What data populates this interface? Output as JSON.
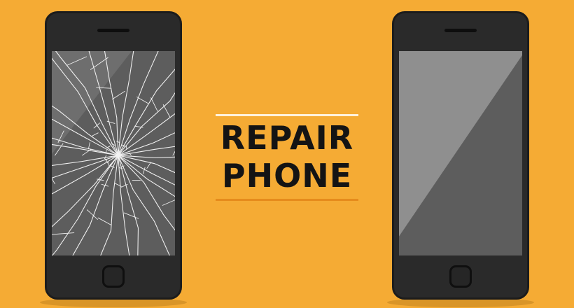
{
  "title": {
    "line1": "REPAIR",
    "line2": "PHONE"
  },
  "colors": {
    "background": "#f5ab34",
    "phone_body": "#2a2a2a",
    "screen": "#5d5d5d",
    "crack": "#f2f2f2",
    "title_text": "#141414",
    "top_rule": "#fff2dc",
    "bottom_rule": "#e58b1c"
  },
  "phones": [
    {
      "id": "broken",
      "screen_state": "cracked"
    },
    {
      "id": "repaired",
      "screen_state": "intact"
    }
  ]
}
